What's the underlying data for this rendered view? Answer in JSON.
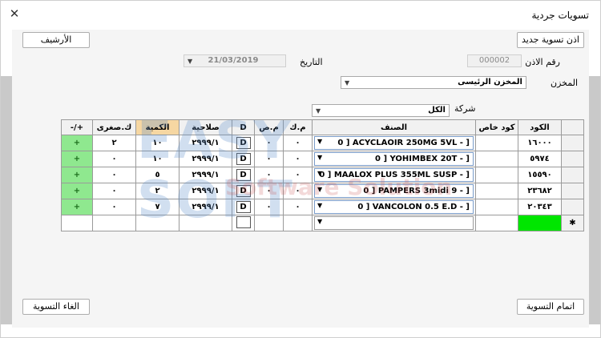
{
  "window": {
    "title": "تسويات جردية",
    "close_glyph": "✕"
  },
  "buttons": {
    "new_settlement": "اذن تسوية جديد",
    "archive": "الأرشيف",
    "complete_settlement": "اتمام التسوية",
    "cancel_settlement": "الغاء التسوية"
  },
  "form": {
    "voucher_no_label": "رقم الاذن",
    "voucher_no": "000002",
    "date_label": "التاريخ",
    "date_value": "21/03/2019",
    "store_label": "المخزن",
    "store_value": "المخزن الرئيسى",
    "company_label": "شركة",
    "company_value": "الكل"
  },
  "grid": {
    "columns": [
      "",
      "الكود",
      "كود خاص",
      "الصنف",
      "م.ك",
      "م.ص",
      "D",
      "صلاحية",
      "الكمية",
      "ك.صغرى",
      "+/-"
    ],
    "rows": [
      {
        "code": "١٦٠٠٠",
        "special": "",
        "item": "0  ]   ACYCLAOIR 250MG 5VL -  ]",
        "mk": "٠",
        "ms": "٠",
        "d": "D",
        "expiry": "٢٩٩٩/١",
        "qty": "١٠",
        "small": "٢",
        "sign": "+"
      },
      {
        "code": "٥٩٧٤",
        "special": "",
        "item": "0  ]   YOHIMBEX 20T -  ]",
        "mk": "٠",
        "ms": "٠",
        "d": "D",
        "expiry": "٢٩٩٩/١",
        "qty": "١٠",
        "small": "٠",
        "sign": "+"
      },
      {
        "code": "١٥٥٩٠",
        "special": "",
        "item": "0  ]   MAALOX PLUS 355ML SUSP -  ]",
        "mk": "٠",
        "ms": "٠",
        "d": "D",
        "expiry": "٢٩٩٩/١",
        "qty": "٥",
        "small": "٠",
        "sign": "+"
      },
      {
        "code": "٢٣٦٨٢",
        "special": "",
        "item": "0  ]   PAMPERS 3midi 9 -  ]",
        "mk": "٠",
        "ms": "٠",
        "d": "D",
        "expiry": "٢٩٩٩/١",
        "qty": "٢",
        "small": "٠",
        "sign": "+"
      },
      {
        "code": "٢٠٣٤٣",
        "special": "",
        "item": "0  ]   VANCOLON 0.5  E.D -  ]",
        "mk": "٠",
        "ms": "٠",
        "d": "D",
        "expiry": "٢٩٩٩/١",
        "qty": "٧",
        "small": "٠",
        "sign": "+"
      }
    ],
    "new_row_marker": "✱"
  },
  "watermark": {
    "line1": "EASY SOFT",
    "line2": "Software Solution"
  },
  "colors": {
    "plus_cell": "#8fe88f",
    "new_code_cell": "#00e600",
    "qty_header": "#f6d7a2"
  }
}
